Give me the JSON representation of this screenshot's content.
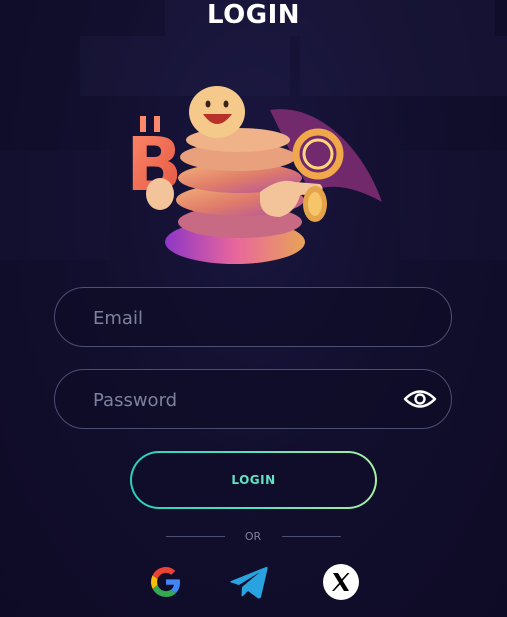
{
  "header": {
    "title": "LOGIN"
  },
  "form": {
    "email_placeholder": "Email",
    "email_value": "",
    "password_placeholder": "Password",
    "password_value": "",
    "show_password_icon": "eye-icon",
    "submit_label": "LOGIN"
  },
  "divider": {
    "label": "OR"
  },
  "social": [
    {
      "name": "Google",
      "icon": "google-icon"
    },
    {
      "name": "Telegram",
      "icon": "telegram-icon"
    },
    {
      "name": "X",
      "icon": "x-icon"
    }
  ],
  "colors": {
    "background": "#120f2e",
    "field_border": "#4b4f72",
    "accent": "#5fe3c4",
    "placeholder": "#7e819e"
  }
}
